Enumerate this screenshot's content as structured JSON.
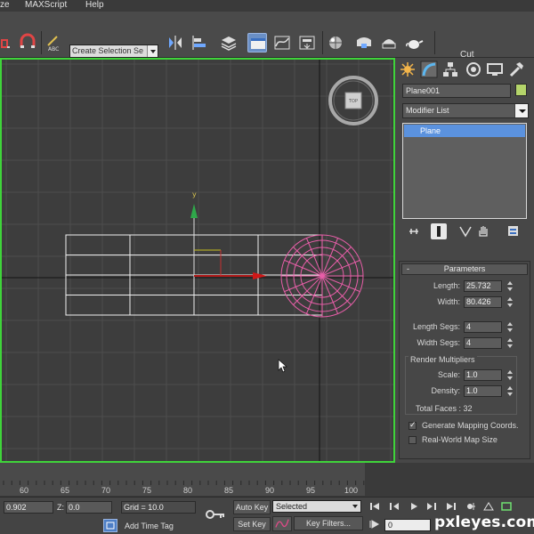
{
  "menu": {
    "items": [
      "ze",
      "MAXScript",
      "Help"
    ]
  },
  "toolbar": {
    "selection_set": "Create Selection Se",
    "cut_label": "Cut",
    "icons": [
      "snap-icon",
      "magnet-icon",
      "spell-abc-icon",
      "mirror-icon",
      "align-icon",
      "layers-icon",
      "scene-explorer-icon",
      "curve-editor-icon",
      "schematic-icon",
      "material-editor-icon",
      "render-setup-icon",
      "render-frame-icon",
      "render-teapot-icon"
    ]
  },
  "viewport": {
    "viewcube_label": "TOP",
    "y_axis_label": "y",
    "border_color": "#3fd43a",
    "wire_color": "#ffffff",
    "selection_color": "#e75ea8"
  },
  "command_panel": {
    "object_name": "Plane001",
    "object_color": "#b4d46a",
    "modifier_list": "Modifier List",
    "stack_item": "Plane",
    "parameters": {
      "title": "Parameters",
      "length_label": "Length:",
      "length_value": "25.732",
      "width_label": "Width:",
      "width_value": "80.426",
      "length_segs_label": "Length Segs:",
      "length_segs_value": "4",
      "width_segs_label": "Width Segs:",
      "width_segs_value": "4",
      "render_multipliers_label": "Render Multipliers",
      "scale_label": "Scale:",
      "scale_value": "1.0",
      "density_label": "Density:",
      "density_value": "1.0",
      "total_faces": "Total Faces : 32",
      "gen_mapping_label": "Generate Mapping Coords.",
      "gen_mapping_checked": true,
      "real_world_label": "Real-World Map Size",
      "real_world_checked": false
    }
  },
  "timeline": {
    "ticks": [
      "60",
      "65",
      "70",
      "75",
      "80",
      "85",
      "90",
      "95",
      "100"
    ]
  },
  "status": {
    "y_value": "0.902",
    "z_label": "Z:",
    "z_value": "0.0",
    "grid": "Grid = 10.0",
    "add_time_tag": "Add Time Tag",
    "auto_key": "Auto Key",
    "set_key": "Set Key",
    "selected": "Selected",
    "key_filters": "Key Filters...",
    "frame_value": "0"
  },
  "watermark": "pxleyes.com"
}
